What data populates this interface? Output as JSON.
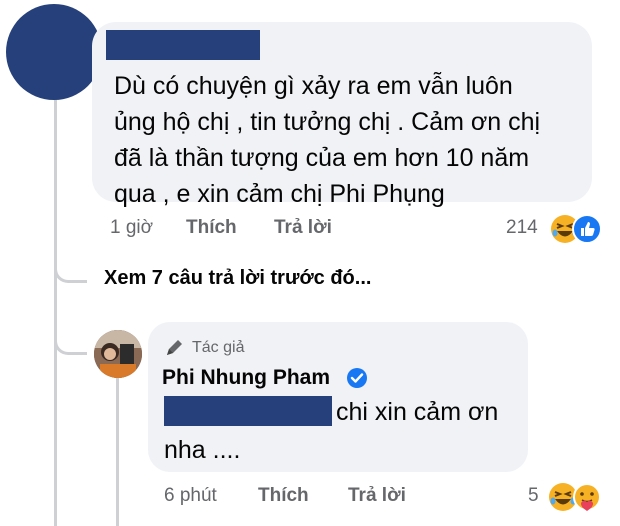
{
  "comment": {
    "text_lines": [
      "Dù có chuyện gì xảy ra em vẫn luôn",
      "ủng hộ chị , tin tưởng chị . Cảm ơn chị",
      "đã là thần tượng của em hơn 10 năm",
      "qua , e xin cảm chị Phi Phụng"
    ],
    "time": "1 giờ",
    "like_label": "Thích",
    "reply_label": "Trả lời",
    "reaction_count": "214",
    "reaction_icons": [
      "laughing-emoji",
      "like-thumb"
    ]
  },
  "view_previous": {
    "label": "Xem 7 câu trả lời trước đó..."
  },
  "reply": {
    "badge_label": "Tác giả",
    "author_name": "Phi Nhung Pham",
    "verified": true,
    "text_line1": "chi xin cảm ơn",
    "text_line2": "nha ....",
    "time": "6 phút",
    "like_label": "Thích",
    "reply_label": "Trả lời",
    "reaction_count": "5",
    "reaction_icons": [
      "laughing-emoji",
      "care-emoji"
    ]
  },
  "colors": {
    "avatar_placeholder": "#25407a",
    "redaction": "#25407a",
    "bubble_bg": "#f0f2f5",
    "verified_blue": "#1877f2",
    "meta_gray": "#65676b"
  }
}
